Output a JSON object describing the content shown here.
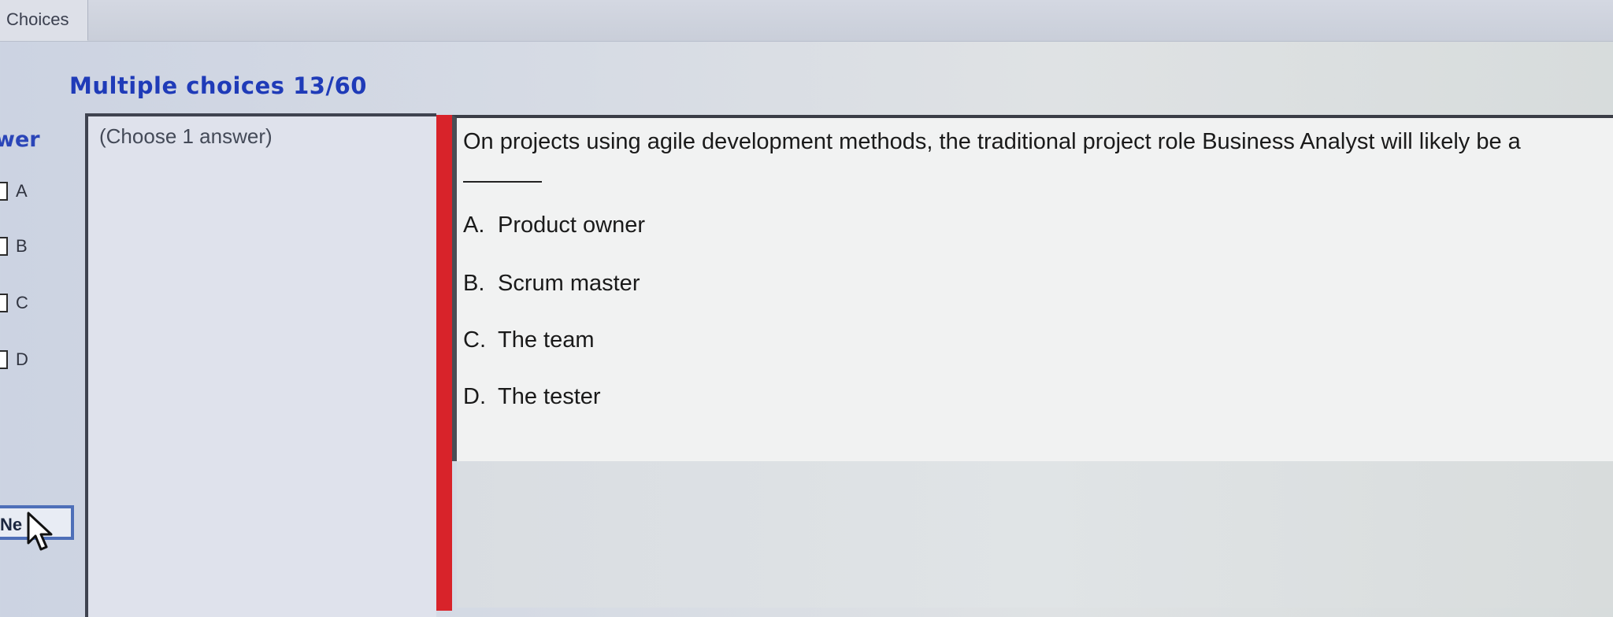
{
  "tabs": [
    {
      "label": "Choices"
    }
  ],
  "section": {
    "title": "Multiple choices 13/60"
  },
  "answer_panel": {
    "header": "wer",
    "options": [
      "A",
      "B",
      "C",
      "D"
    ],
    "next_button": "Ne"
  },
  "instruction": {
    "text": "(Choose 1 answer)"
  },
  "question": {
    "text": "On projects using agile development methods, the traditional project role Business Analyst will likely be a",
    "choices": [
      {
        "letter": "A.",
        "text": "Product owner"
      },
      {
        "letter": "B.",
        "text": "Scrum master"
      },
      {
        "letter": "C.",
        "text": "The team"
      },
      {
        "letter": "D.",
        "text": "The tester"
      }
    ]
  },
  "colors": {
    "title_blue": "#1f3bb8",
    "accent_red": "#d8232a"
  }
}
